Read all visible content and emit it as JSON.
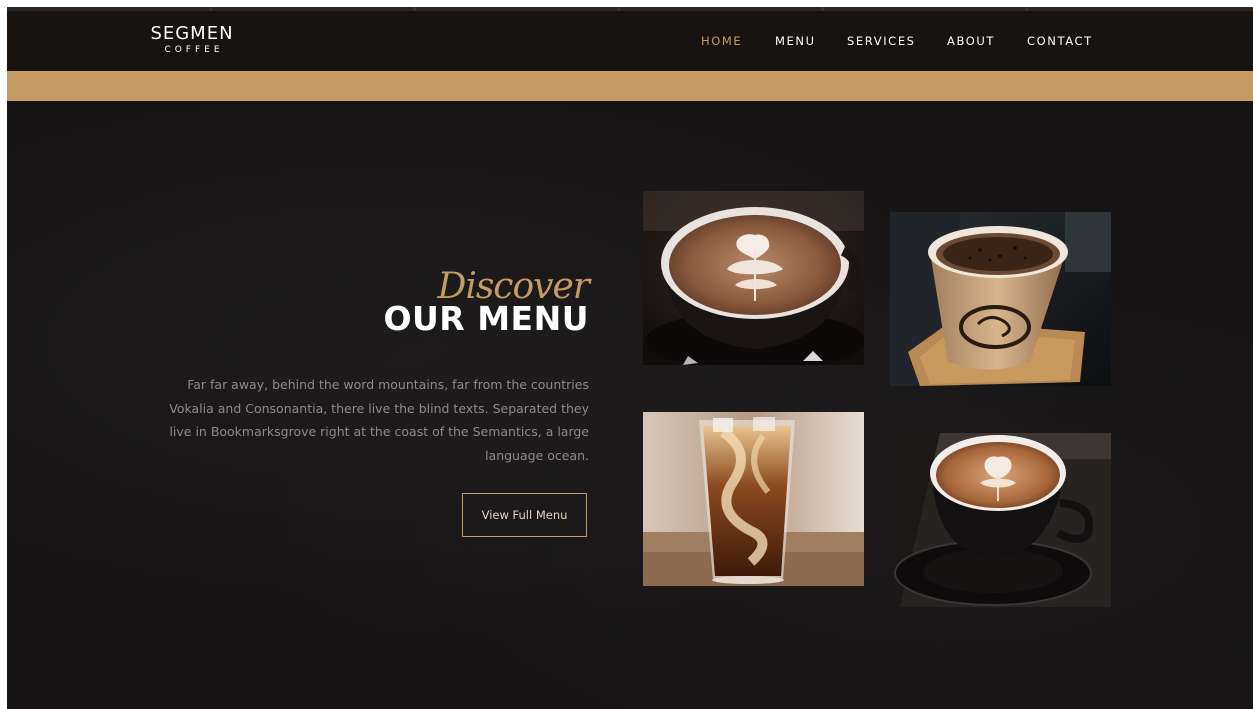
{
  "brand": {
    "name": "SEGMEN",
    "tagline": "COFFEE"
  },
  "nav": {
    "items": [
      {
        "label": "HOME",
        "active": true
      },
      {
        "label": "MENU",
        "active": false
      },
      {
        "label": "SERVICES",
        "active": false
      },
      {
        "label": "ABOUT",
        "active": false
      },
      {
        "label": "CONTACT",
        "active": false
      }
    ]
  },
  "hero": {
    "subtitle": "Discover",
    "title": "OUR MENU",
    "description": "Far far away, behind the word mountains, far from the countries Vokalia and Consonantia, there live the blind texts. Separated they live in Bookmarksgrove right at the coast of the Semantics, a large language ocean.",
    "button_label": "View Full Menu"
  },
  "gallery": {
    "images": [
      {
        "subject": "latte-art-cup"
      },
      {
        "subject": "takeaway-coffee-cup"
      },
      {
        "subject": "iced-coffee-glass"
      },
      {
        "subject": "cappuccino-cup"
      }
    ]
  },
  "colors": {
    "accent": "#c49b62",
    "navbar": "#161310",
    "background": "#151313",
    "text_muted": "#8f8a85"
  }
}
